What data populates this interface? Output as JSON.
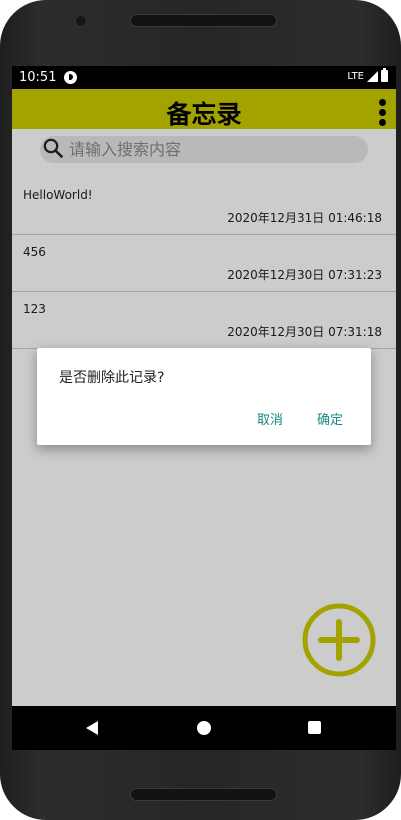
{
  "status_bar": {
    "time": "10:51",
    "network": "LTE"
  },
  "app_bar": {
    "title": "备忘录"
  },
  "search": {
    "placeholder": "请输入搜索内容"
  },
  "memos": [
    {
      "text": "HelloWorld!",
      "time": "2020年12月31日 01:46:18"
    },
    {
      "text": "456",
      "time": "2020年12月30日 07:31:23"
    },
    {
      "text": "123",
      "time": "2020年12月30日 07:31:18"
    }
  ],
  "dialog": {
    "message": "是否删除此记录?",
    "cancel_label": "取消",
    "ok_label": "确定"
  },
  "colors": {
    "app_bar": "#cccc00",
    "dialog_button": "#148a80",
    "fab": "#cccc00"
  },
  "icons": {
    "search": "search-icon",
    "overflow": "more-vert-icon",
    "fab": "add-circle-icon"
  }
}
